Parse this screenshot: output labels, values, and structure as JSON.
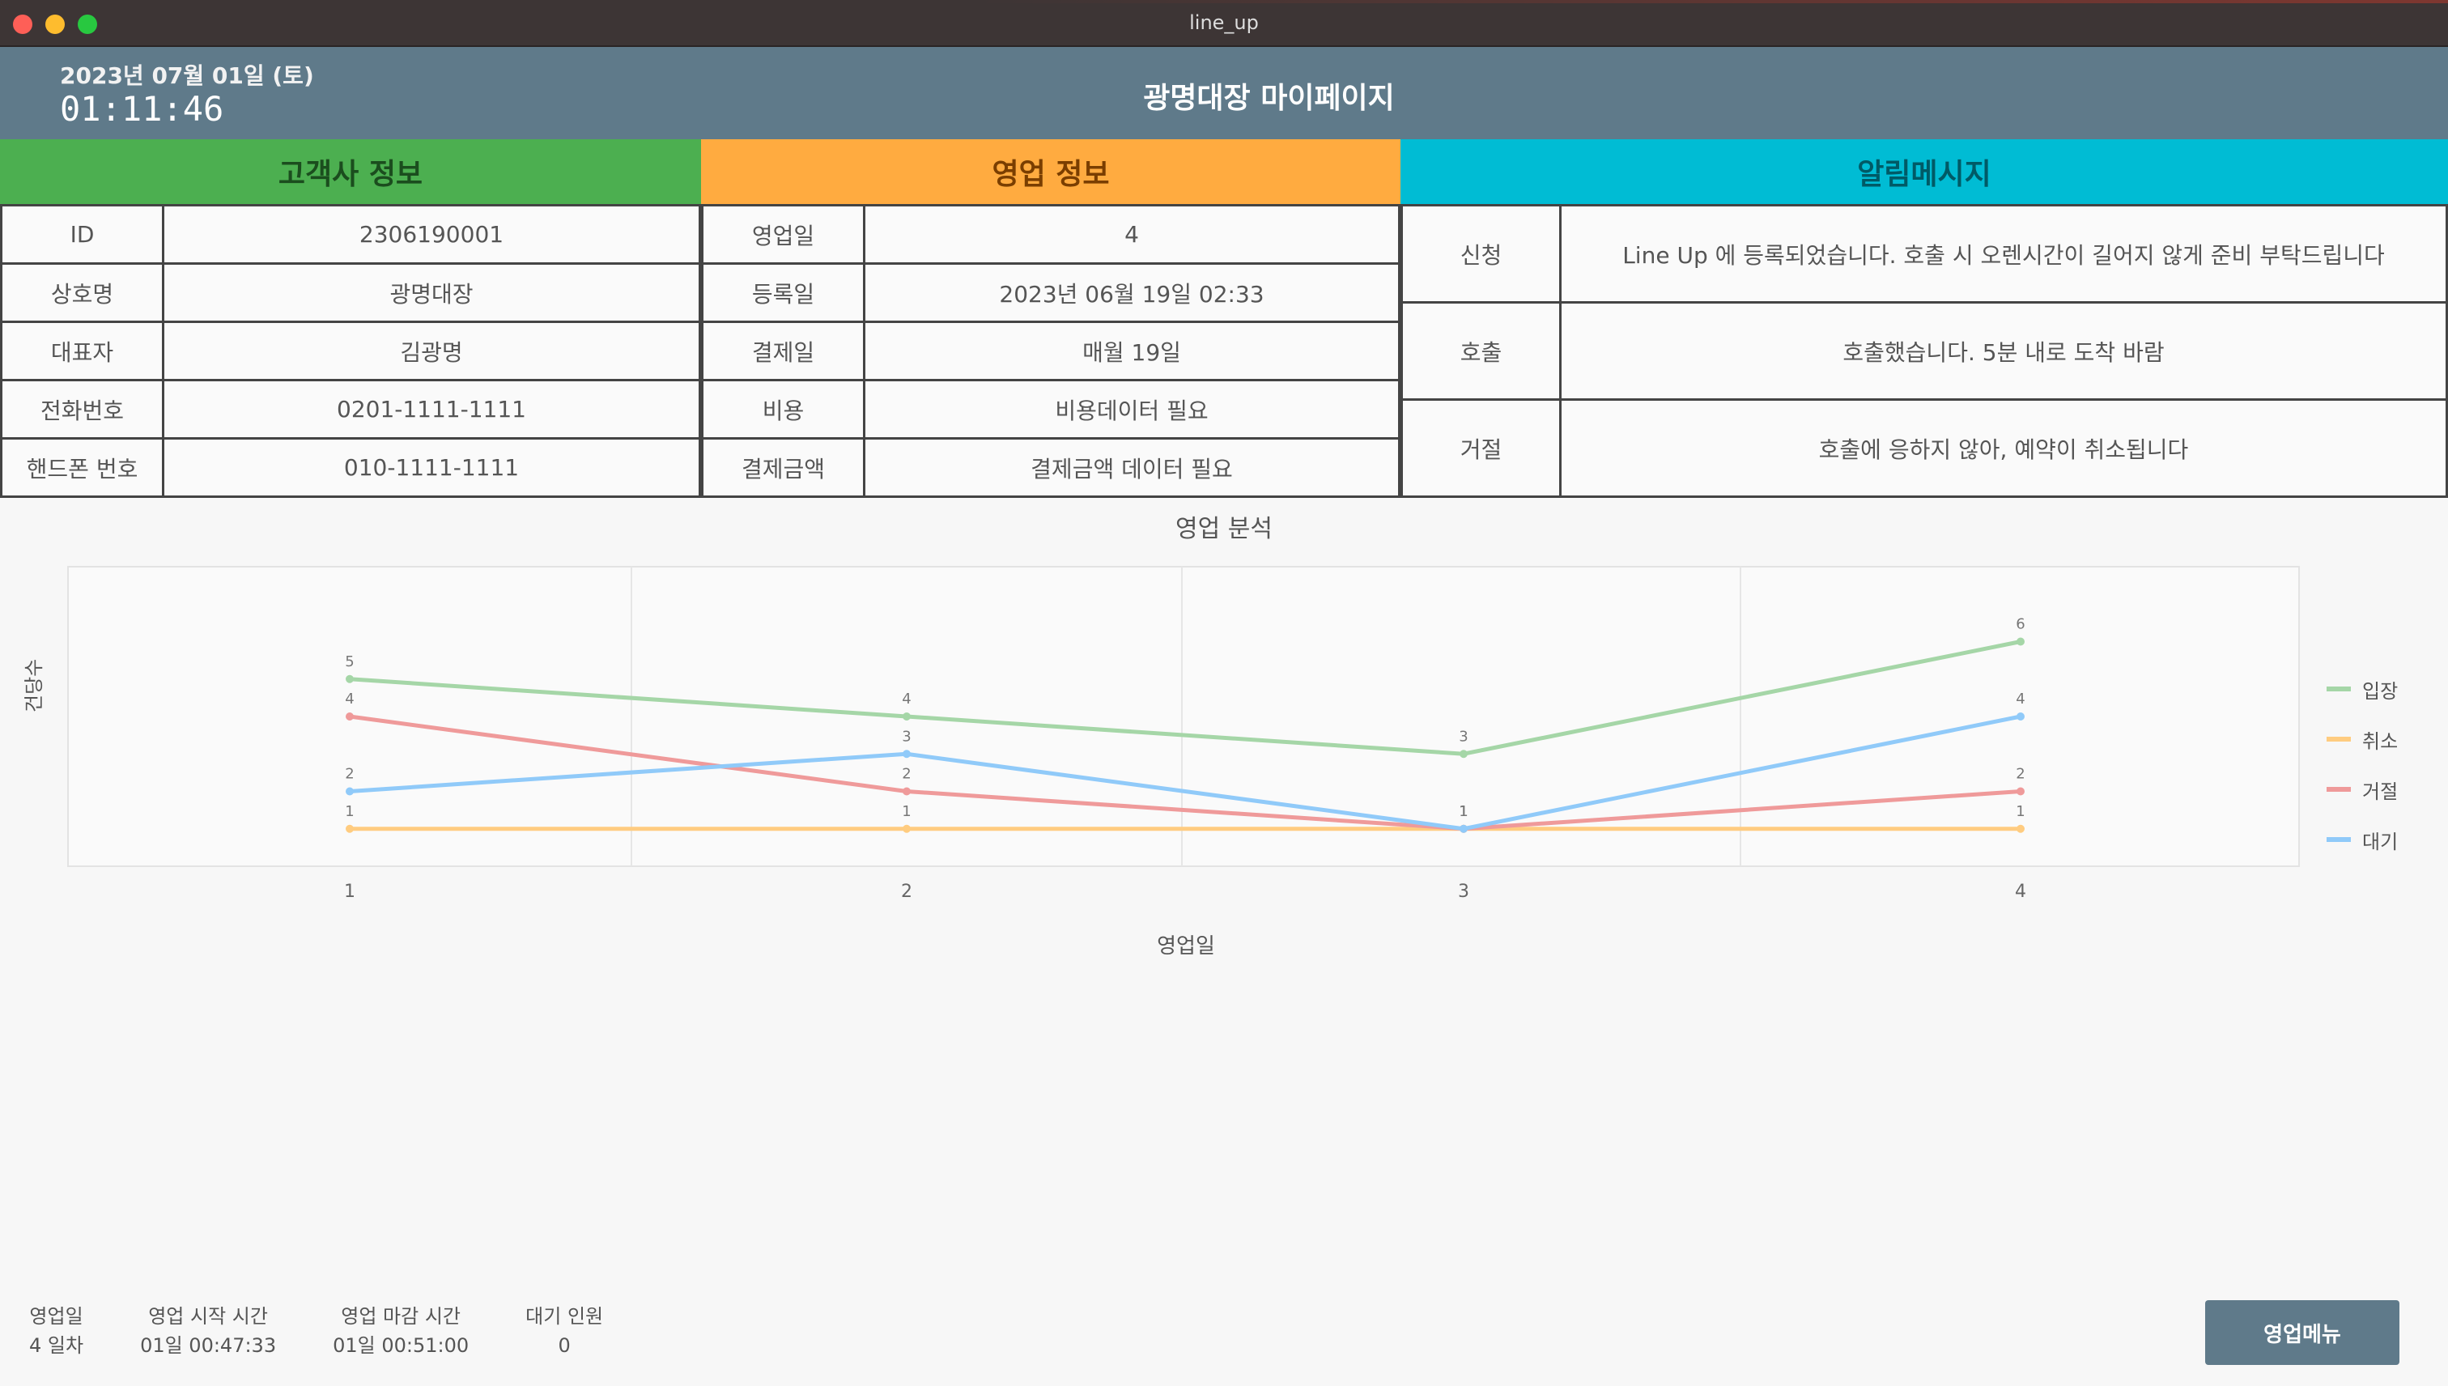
{
  "window": {
    "title": "line_up"
  },
  "header": {
    "date": "2023년 07월 01일 (토)",
    "time": "01:11:46",
    "title": "광명대장 마이페이지"
  },
  "customer": {
    "heading": "고객사 정보",
    "rows": [
      {
        "label": "ID",
        "value": "2306190001"
      },
      {
        "label": "상호명",
        "value": "광명대장"
      },
      {
        "label": "대표자",
        "value": "김광명"
      },
      {
        "label": "전화번호",
        "value": "0201-1111-1111"
      },
      {
        "label": "핸드폰 번호",
        "value": "010-1111-1111"
      }
    ]
  },
  "sales": {
    "heading": "영업 정보",
    "rows": [
      {
        "label": "영업일",
        "value": "4"
      },
      {
        "label": "등록일",
        "value": "2023년 06월 19일 02:33"
      },
      {
        "label": "결제일",
        "value": "매월 19일"
      },
      {
        "label": "비용",
        "value": "비용데이터 필요"
      },
      {
        "label": "결제금액",
        "value": "결제금액 데이터 필요"
      }
    ]
  },
  "messages": {
    "heading": "알림메시지",
    "rows": [
      {
        "label": "신청",
        "value": "Line Up 에 등록되었습니다. 호출 시 오렌시간이 길어지 않게 준비 부탁드립니다"
      },
      {
        "label": "호출",
        "value": "호출했습니다. 5분 내로 도착 바람"
      },
      {
        "label": "거절",
        "value": "호출에 응하지 않아, 예약이 취소됩니다"
      }
    ]
  },
  "chart_data": {
    "type": "line",
    "title": "영업 분석",
    "xlabel": "영업일",
    "ylabel": "건당수",
    "x": [
      1,
      2,
      3,
      4
    ],
    "ylim": [
      0,
      8
    ],
    "grid": true,
    "legend": "right",
    "series": [
      {
        "name": "입장",
        "color": "#a5d6a7",
        "values": [
          5,
          4,
          3,
          6
        ]
      },
      {
        "name": "취소",
        "color": "#ffcc80",
        "values": [
          1,
          1,
          1,
          1
        ]
      },
      {
        "name": "거절",
        "color": "#ef9a9a",
        "values": [
          4,
          2,
          1,
          2
        ]
      },
      {
        "name": "대기",
        "color": "#90caf9",
        "values": [
          2,
          3,
          1,
          4
        ]
      }
    ]
  },
  "footer": {
    "stats": [
      {
        "label": "영업일",
        "value": "4 일차"
      },
      {
        "label": "영업 시작 시간",
        "value": "01일 00:47:33"
      },
      {
        "label": "영업 마감 시간",
        "value": "01일 00:51:00"
      },
      {
        "label": "대기 인원",
        "value": "0"
      }
    ],
    "menu_button": "영업메뉴"
  }
}
